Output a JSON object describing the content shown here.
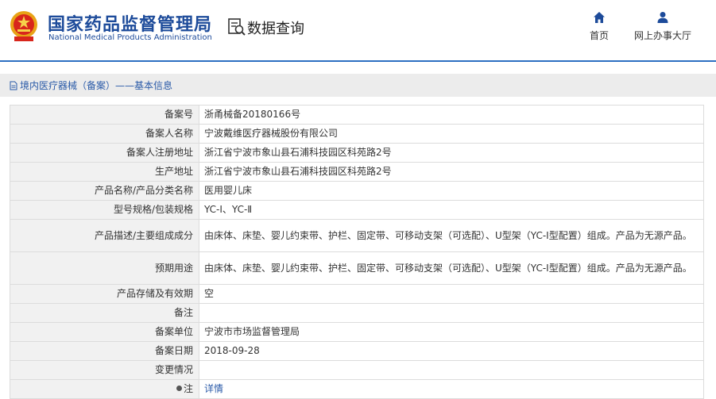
{
  "header": {
    "org_name_cn": "国家药品监督管理局",
    "org_name_en": "National Medical Products Administration",
    "search_title": "数据查询",
    "nav": [
      {
        "label": "首页",
        "icon": "home-icon"
      },
      {
        "label": "网上办事大厅",
        "icon": "user-icon"
      }
    ],
    "accent_color": "#2d6fc2"
  },
  "breadcrumb": {
    "icon": "document-icon",
    "text": "境内医疗器械（备案）——基本信息"
  },
  "details": [
    {
      "label": "备案号",
      "value": "浙甬械备20180166号"
    },
    {
      "label": "备案人名称",
      "value": "宁波戴维医疗器械股份有限公司"
    },
    {
      "label": "备案人注册地址",
      "value": "浙江省宁波市象山县石浦科技园区科苑路2号"
    },
    {
      "label": "生产地址",
      "value": "浙江省宁波市象山县石浦科技园区科苑路2号"
    },
    {
      "label": "产品名称/产品分类名称",
      "value": "医用婴儿床"
    },
    {
      "label": "型号规格/包装规格",
      "value": "YC-Ⅰ、YC-Ⅱ"
    },
    {
      "label": "产品描述/主要组成成分",
      "value": "由床体、床垫、婴儿约束带、护栏、固定带、可移动支架（可选配）、U型架（YC-I型配置）组成。产品为无源产品。"
    },
    {
      "label": "预期用途",
      "value": "由床体、床垫、婴儿约束带、护栏、固定带、可移动支架（可选配）、U型架（YC-I型配置）组成。产品为无源产品。"
    },
    {
      "label": "产品存储及有效期",
      "value": "空"
    },
    {
      "label": "备注",
      "value": ""
    },
    {
      "label": "备案单位",
      "value": "宁波市市场监督管理局"
    },
    {
      "label": "备案日期",
      "value": "2018-09-28"
    },
    {
      "label": "变更情况",
      "value": ""
    }
  ],
  "note": {
    "label": "注",
    "link_text": "详情",
    "icon": "lightbulb-icon"
  }
}
